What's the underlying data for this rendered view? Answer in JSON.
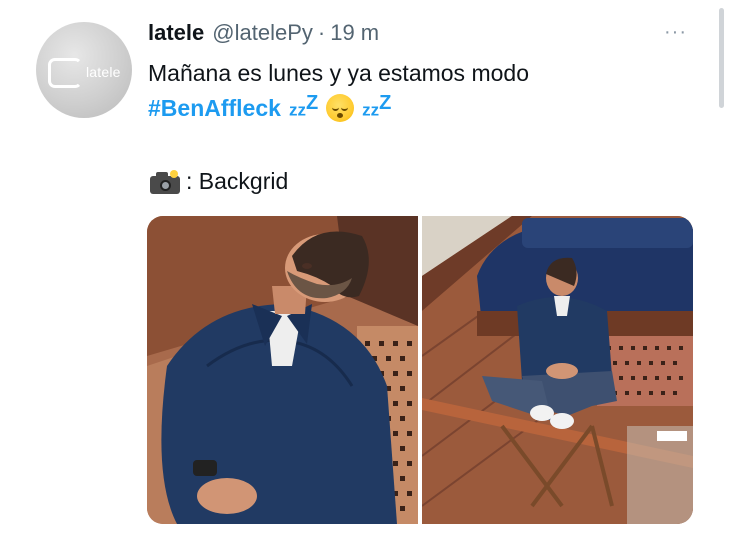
{
  "tweet": {
    "display_name": "latele",
    "handle": "@latelePy",
    "separator": "·",
    "time": "19 m",
    "avatar_text": "latele",
    "more_label": "···",
    "text_line1": "Mañana es lunes y ya estamos modo",
    "hashtag": "#BenAffleck",
    "zzz_left": "zz",
    "zzz_left_sup": "Z",
    "zzz_right": "zz",
    "zzz_right_sup": "Z",
    "emoji": "sleeping-face",
    "credit_text": ": Backgrid"
  },
  "media": {
    "photos": [
      {
        "description_icon": "photo-closeup"
      },
      {
        "description_icon": "photo-boat"
      }
    ]
  },
  "colors": {
    "link": "#1d9bf0",
    "text": "#0f1419",
    "muted": "#536471"
  }
}
